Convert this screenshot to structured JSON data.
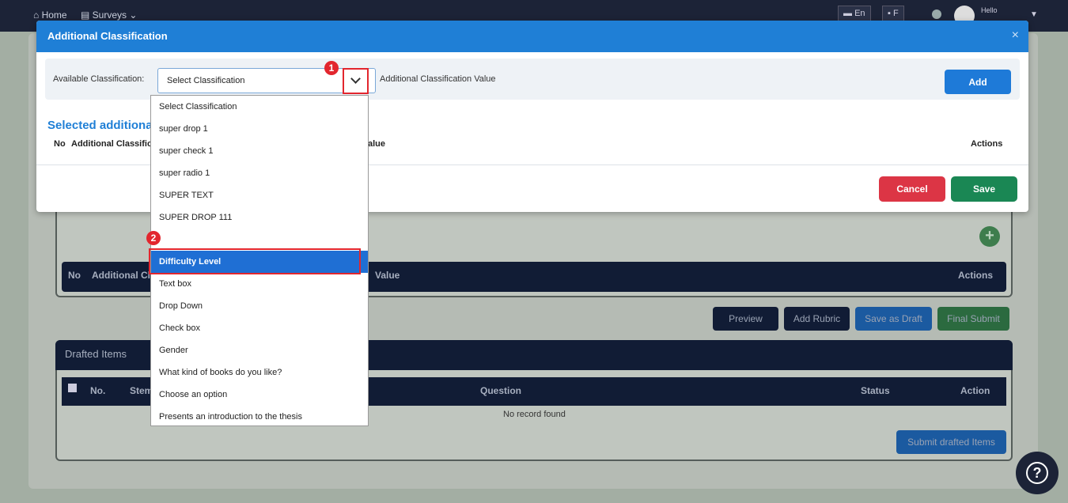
{
  "nav": {
    "home": "Home",
    "surveys": "Surveys",
    "lang": "En",
    "hello": "Hello",
    "user_short": "F"
  },
  "background": {
    "table1_headers": [
      "No",
      "Additional Cl",
      "Value",
      "Actions"
    ],
    "buttons": {
      "preview": "Preview",
      "add_rubric": "Add Rubric",
      "save_draft": "Save as Draft",
      "final_submit": "Final Submit"
    },
    "drafted_title": "Drafted Items",
    "table2_headers": [
      "No.",
      "Stem",
      "Question",
      "Status",
      "Action"
    ],
    "no_record": "No record found",
    "submit_drafted": "Submit drafted Items"
  },
  "modal": {
    "title": "Additional Classification",
    "close": "×",
    "available_label": "Available Classification:",
    "select_value": "Select Classification",
    "value_label": "Additional Classification Value",
    "add_label": "Add",
    "selected_title": "Selected additiona",
    "headers": {
      "no": "No",
      "classif": "Additional Classifica",
      "value": "alue",
      "actions": "Actions"
    },
    "cancel": "Cancel",
    "save": "Save"
  },
  "dropdown": {
    "options": [
      "Select Classification",
      "super drop 1",
      "super check 1",
      "super radio 1",
      "SUPER TEXT",
      "SUPER DROP 111",
      "",
      "Difficulty Level",
      "Text box",
      "Drop Down",
      "Check box",
      "Gender",
      "What kind of books do you like?",
      "Choose an option",
      "Presents an introduction to the thesis"
    ],
    "selected_index": 7
  },
  "badges": {
    "one": "1",
    "two": "2"
  },
  "colors": {
    "primary": "#1f7fd6",
    "danger": "#dc3545",
    "success": "#1a8754",
    "annotation": "#e2262e",
    "navy": "#111c35"
  }
}
